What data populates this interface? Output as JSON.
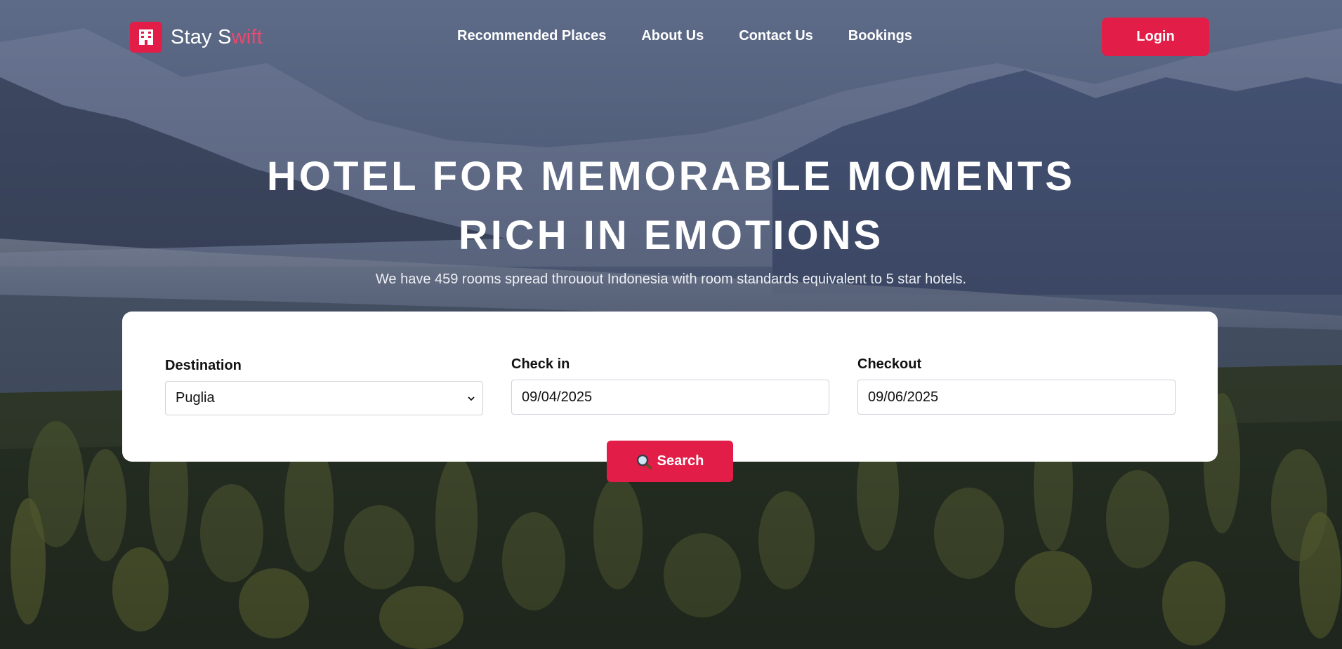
{
  "brand": {
    "name_start": "Stay S",
    "name_accent": "wift",
    "accent_color": "#e11d48",
    "icon": "hotel-icon"
  },
  "nav": {
    "links": [
      "Recommended Places",
      "About Us",
      "Contact Us",
      "Bookings"
    ],
    "login_label": "Login"
  },
  "hero": {
    "headline_line1": "HOTEL FOR MEMORABLE MOMENTS",
    "headline_line2": "RICH IN EMOTIONS",
    "subheadline": "We have 459 rooms spread throuout Indonesia with room standards equivalent to 5 star hotels."
  },
  "search": {
    "destination_label": "Destination",
    "destination_value": "Puglia",
    "checkin_label": "Check in",
    "checkin_value": "09/04/2025",
    "checkout_label": "Checkout",
    "checkout_value": "09/06/2025",
    "search_label": "Search",
    "search_icon": "magnifier-icon"
  }
}
